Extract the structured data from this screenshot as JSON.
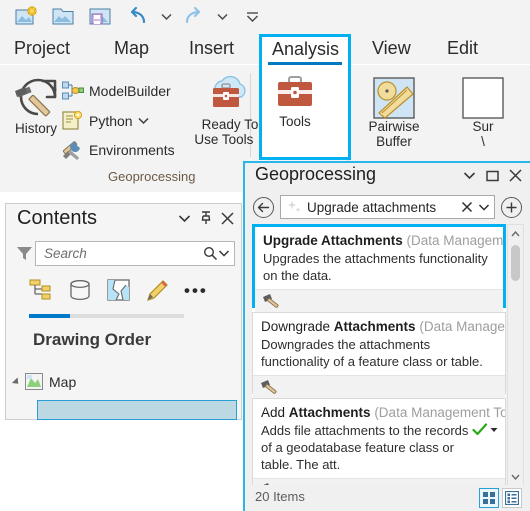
{
  "app": {
    "quick_access": [
      {
        "name": "new-project-icon",
        "label": "New Project"
      },
      {
        "name": "open-project-icon",
        "label": "Open Project"
      },
      {
        "name": "save-project-icon",
        "label": "Save Project"
      },
      {
        "name": "undo-icon",
        "label": "Undo"
      },
      {
        "name": "undo-dropdown-icon",
        "label": "Undo options"
      },
      {
        "name": "redo-icon",
        "label": "Redo"
      },
      {
        "name": "redo-dropdown-icon",
        "label": "Redo options"
      },
      {
        "name": "customize-quick-access-icon",
        "label": "Customize Quick Access Toolbar"
      }
    ]
  },
  "ribbon": {
    "tabs": [
      {
        "label": "Project",
        "active": false
      },
      {
        "label": "Map",
        "active": false
      },
      {
        "label": "Insert",
        "active": false
      },
      {
        "label": "Analysis",
        "active": true
      },
      {
        "label": "View",
        "active": false
      },
      {
        "label": "Edit",
        "active": false
      }
    ],
    "groups": [
      {
        "label": "Geoprocessing"
      }
    ],
    "items": [
      {
        "label": "History",
        "icon": "history-icon"
      },
      {
        "label": "ModelBuilder",
        "icon": "modelbuilder-icon"
      },
      {
        "label": "Python",
        "icon": "python-icon",
        "has_dropdown": true
      },
      {
        "label": "Environments",
        "icon": "environments-icon"
      },
      {
        "label": "Ready To\nUse Tools",
        "line1": "Ready To",
        "line2": "Use Tools",
        "icon": "ready-to-use-tools-icon",
        "has_dropdown": true
      },
      {
        "label": "Tools",
        "line1": "Tools",
        "icon": "tools-toolbox-icon",
        "highlighted": true
      },
      {
        "label": "Pairwise Buffer",
        "line1": "Pairwise",
        "line2": "Buffer",
        "icon": "pairwise-buffer-icon"
      },
      {
        "label": "Sur",
        "line1": "Sur",
        "line2": "\\",
        "icon": "summarize-within-icon",
        "clipped": true
      }
    ]
  },
  "contents_pane": {
    "title": "Contents",
    "header_buttons": [
      {
        "name": "menu-chevron-icon",
        "label": "Menu"
      },
      {
        "name": "pin-icon",
        "label": "Auto Hide"
      },
      {
        "name": "close-icon",
        "label": "Close"
      }
    ],
    "filter_icon": "filter-icon",
    "search": {
      "placeholder": "Search",
      "value": "",
      "search_icon": "search-icon",
      "dropdown_icon": "chevron-down-icon"
    },
    "tool_buttons": [
      {
        "name": "list-by-drawing-order-icon",
        "label": "List By Drawing Order"
      },
      {
        "name": "list-by-data-source-icon",
        "label": "List By Data Source"
      },
      {
        "name": "list-by-selection-icon",
        "label": "List By Selection"
      },
      {
        "name": "list-by-editing-icon",
        "label": "List By Editing"
      },
      {
        "name": "more-options-icon",
        "label": "More"
      }
    ],
    "section_title": "Drawing Order",
    "tree": [
      {
        "label": "Map",
        "icon": "map-icon",
        "expanded": true,
        "indent": 0
      }
    ]
  },
  "geoprocessing_pane": {
    "title": "Geoprocessing",
    "header_buttons": [
      {
        "name": "menu-chevron-icon",
        "label": "Menu"
      },
      {
        "name": "maximize-icon",
        "label": "Maximize"
      },
      {
        "name": "close-icon",
        "label": "Close"
      }
    ],
    "back_button": {
      "name": "back-icon",
      "label": "Back"
    },
    "add_button": {
      "name": "add-icon",
      "label": "Add"
    },
    "search": {
      "value": "Upgrade attachments",
      "placeholder": "Search",
      "sparkle_icon": "sparkle-icon",
      "clear_icon": "clear-x-icon",
      "dropdown_icon": "chevron-down-icon"
    },
    "results": [
      {
        "name_prefix": "Upgrade ",
        "name_bold": "Attachments",
        "prefix_bold": true,
        "toolbox": "(Data Management Tools)",
        "description": "Upgrades the attachments functionality on the data.",
        "tool_icon": "hammer-tool-icon",
        "selected": true,
        "has_check": false
      },
      {
        "name_prefix": "Downgrade ",
        "name_bold": "Attachments",
        "prefix_bold": false,
        "toolbox": "(Data Management T...",
        "description": "Downgrades the attachments functionality of a feature class or table.",
        "tool_icon": "hammer-tool-icon",
        "selected": false,
        "has_check": false
      },
      {
        "name_prefix": "Add ",
        "name_bold": "Attachments",
        "prefix_bold": false,
        "toolbox": "(Data Management Too...",
        "description": "Adds file attachments to the records of a geodatabase feature class or table. The att.",
        "tool_icon": "hammer-tool-icon",
        "selected": false,
        "has_check": true,
        "check_icon": "green-check-icon",
        "check_caret_icon": "caret-down-icon"
      }
    ],
    "scrollbar": {
      "up_icon": "scroll-up-icon",
      "down_icon": "scroll-down-icon"
    },
    "status": {
      "item_count": "20 Items",
      "view_buttons": [
        {
          "name": "grid-view-icon",
          "label": "Grid View",
          "active": true
        },
        {
          "name": "list-view-icon",
          "label": "List View",
          "active": false
        }
      ]
    }
  },
  "colors": {
    "highlight": "#00b0f0",
    "tab_underline": "#0079c1",
    "accent_blue": "#0078c8",
    "toolbox_red": "#c0573f",
    "check_green": "#2aa81a",
    "panel_bg": "#f0f0f0",
    "selection_blue": "#bcd9e3"
  }
}
